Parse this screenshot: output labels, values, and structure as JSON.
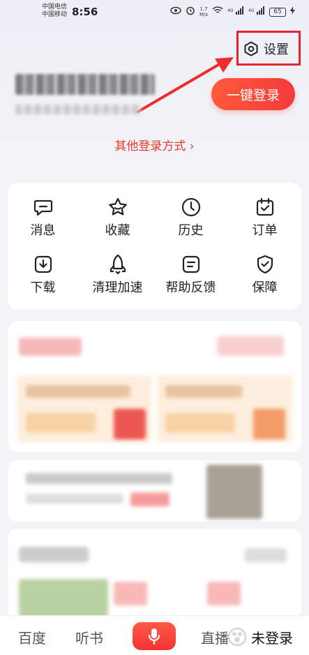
{
  "status_bar": {
    "carrier_1": "中国电信",
    "carrier_2": "中国移动",
    "time": "8:56",
    "net_speed_value": "1.7",
    "net_speed_unit": "M/s",
    "signal_1": "4G",
    "signal_2": "4G",
    "battery": "65"
  },
  "header": {
    "settings_label": "设置",
    "login_button": "一键登录",
    "other_login": "其他登录方式 ›"
  },
  "services": [
    {
      "label": "消息",
      "icon": "message-icon"
    },
    {
      "label": "收藏",
      "icon": "star-icon"
    },
    {
      "label": "历史",
      "icon": "clock-icon"
    },
    {
      "label": "订单",
      "icon": "order-icon"
    },
    {
      "label": "下载",
      "icon": "download-icon"
    },
    {
      "label": "清理加速",
      "icon": "rocket-icon"
    },
    {
      "label": "帮助反馈",
      "icon": "feedback-icon"
    },
    {
      "label": "保障",
      "icon": "shield-icon"
    }
  ],
  "bottom_nav": {
    "tab_1": "百度",
    "tab_2": "听书",
    "tab_voice": "mic-icon",
    "tab_4": "直播",
    "tab_5": "未登录"
  },
  "colors": {
    "accent": "#f33a3a",
    "annotation": "#e0262f",
    "link": "#e53a2d"
  }
}
